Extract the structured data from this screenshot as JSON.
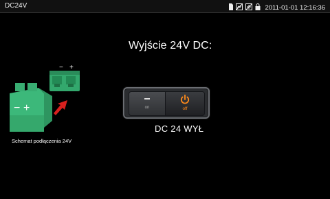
{
  "statusbar": {
    "app_title": "DC24V",
    "datetime": "2011-01-01 12:16:36",
    "icons": [
      "sd-card-icon",
      "network-icon",
      "connection-icon",
      "lock-icon"
    ]
  },
  "main": {
    "heading": "Wyjście 24V DC:",
    "diagram": {
      "caption": "Schemat podłączenia 24V",
      "plug_minus": "−",
      "plug_plus": "+",
      "socket_minus": "−",
      "socket_plus": "+"
    },
    "switch": {
      "on_label": "on",
      "off_label": "off"
    },
    "state": "DC 24 WYŁ"
  },
  "colors": {
    "connector_green": "#3cb87a",
    "arrow_red": "#d8201e",
    "power_orange": "#ff8a1a"
  }
}
